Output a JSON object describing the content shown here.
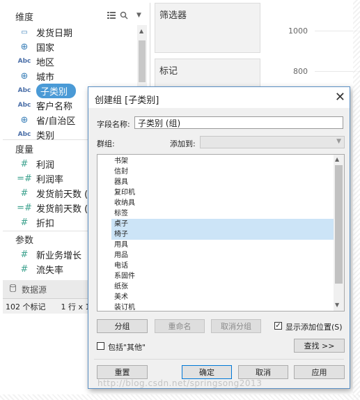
{
  "left_pane": {
    "dimensions_title": "维度",
    "dimensions": [
      {
        "label": "发货日期",
        "icon": "calendar-icon",
        "glyph": "▭"
      },
      {
        "label": "国家",
        "icon": "globe-icon",
        "glyph": "⊕"
      },
      {
        "label": "地区",
        "icon": "abc-icon",
        "glyph": "Abc"
      },
      {
        "label": "城市",
        "icon": "globe-icon",
        "glyph": "⊕"
      },
      {
        "label": "子类别",
        "icon": "abc-icon",
        "glyph": "Abc"
      },
      {
        "label": "客户名称",
        "icon": "abc-icon",
        "glyph": "Abc"
      },
      {
        "label": "省/自治区",
        "icon": "globe-icon",
        "glyph": "⊕"
      },
      {
        "label": "类别",
        "icon": "abc-icon",
        "glyph": "Abc"
      }
    ],
    "measures_title": "度量",
    "measures": [
      {
        "label": "利润",
        "glyph": "#"
      },
      {
        "label": "利润率",
        "glyph": "=#"
      },
      {
        "label": "发货前天数 (",
        "glyph": "#"
      },
      {
        "label": "发货前天数 (",
        "glyph": "=#"
      },
      {
        "label": "折扣",
        "glyph": "#"
      }
    ],
    "parameters_title": "参数",
    "parameters": [
      {
        "label": "新业务增长",
        "glyph": "#"
      },
      {
        "label": "流失率",
        "glyph": "#"
      }
    ],
    "datasource_label": "数据源",
    "status_marks": "102 个标记",
    "status_rows": "1 行 x 1"
  },
  "cards": {
    "filters_title": "筛选器",
    "marks_title": "标记"
  },
  "chart": {
    "ticks": [
      "1000",
      "800"
    ]
  },
  "dialog": {
    "title": "创建组 [子类别]",
    "field_name_label": "字段名称:",
    "field_name_value": "子类别 (组)",
    "group_label": "群组:",
    "add_to_label": "添加到:",
    "items": [
      "书架",
      "信封",
      "器具",
      "复印机",
      "收纳具",
      "标签",
      "桌子",
      "椅子",
      "用具",
      "用品",
      "电话",
      "系固件",
      "纸张",
      "美术",
      "装订机"
    ],
    "selected_items": [
      "桌子",
      "椅子"
    ],
    "group_button": "分组",
    "rename_button": "重命名",
    "ungroup_button": "取消分组",
    "show_add_location_label": "显示添加位置(S)",
    "show_add_location_checked": true,
    "include_other_label": "包括\"其他\"",
    "include_other_checked": false,
    "find_button": "查找 >>",
    "reset_button": "重置",
    "ok_button": "确定",
    "cancel_button": "取消",
    "apply_button": "应用"
  },
  "watermark": "http://blog.csdn.net/springsong2013"
}
